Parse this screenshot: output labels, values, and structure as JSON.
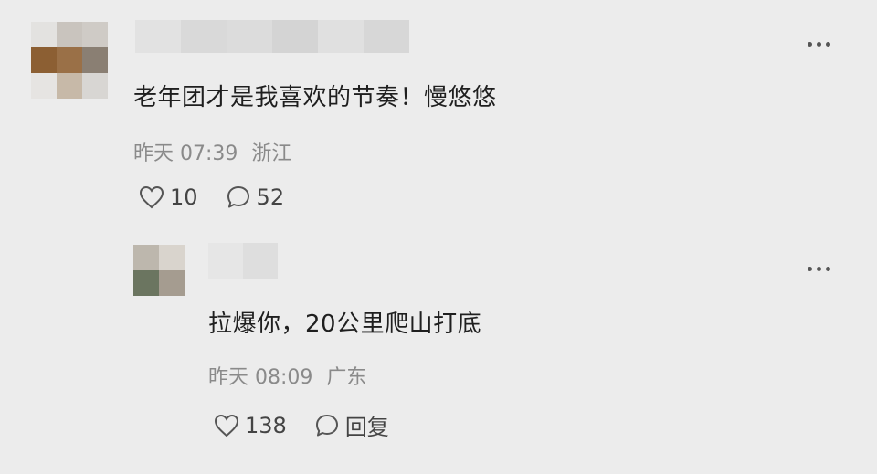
{
  "comments": [
    {
      "text": "老年团才是我喜欢的节奏！慢悠悠",
      "time": "昨天 07:39",
      "location": "浙江",
      "likes": "10",
      "replies": "52",
      "avatar_colors": [
        "#e3e2e0",
        "#c9c4be",
        "#cfcbc6",
        "#8c5f33",
        "#9a7047",
        "#8a7f73",
        "#e6e4e2",
        "#c7b9a8",
        "#d8d6d3"
      ],
      "name_blur_colors": [
        "#e2e2e2",
        "#d9d9d9",
        "#dcdcdc",
        "#d4d4d4",
        "#e0e0e0",
        "#d7d7d7"
      ]
    },
    {
      "text": "拉爆你，20公里爬山打底",
      "time": "昨天 08:09",
      "location": "广东",
      "likes": "138",
      "reply_label": "回复",
      "avatar_colors": [
        "#bdb7ad",
        "#d9d4cd",
        "#6b7560",
        "#a59c90"
      ],
      "name_blur_colors": [
        "#e6e6e6",
        "#dedede"
      ]
    }
  ]
}
